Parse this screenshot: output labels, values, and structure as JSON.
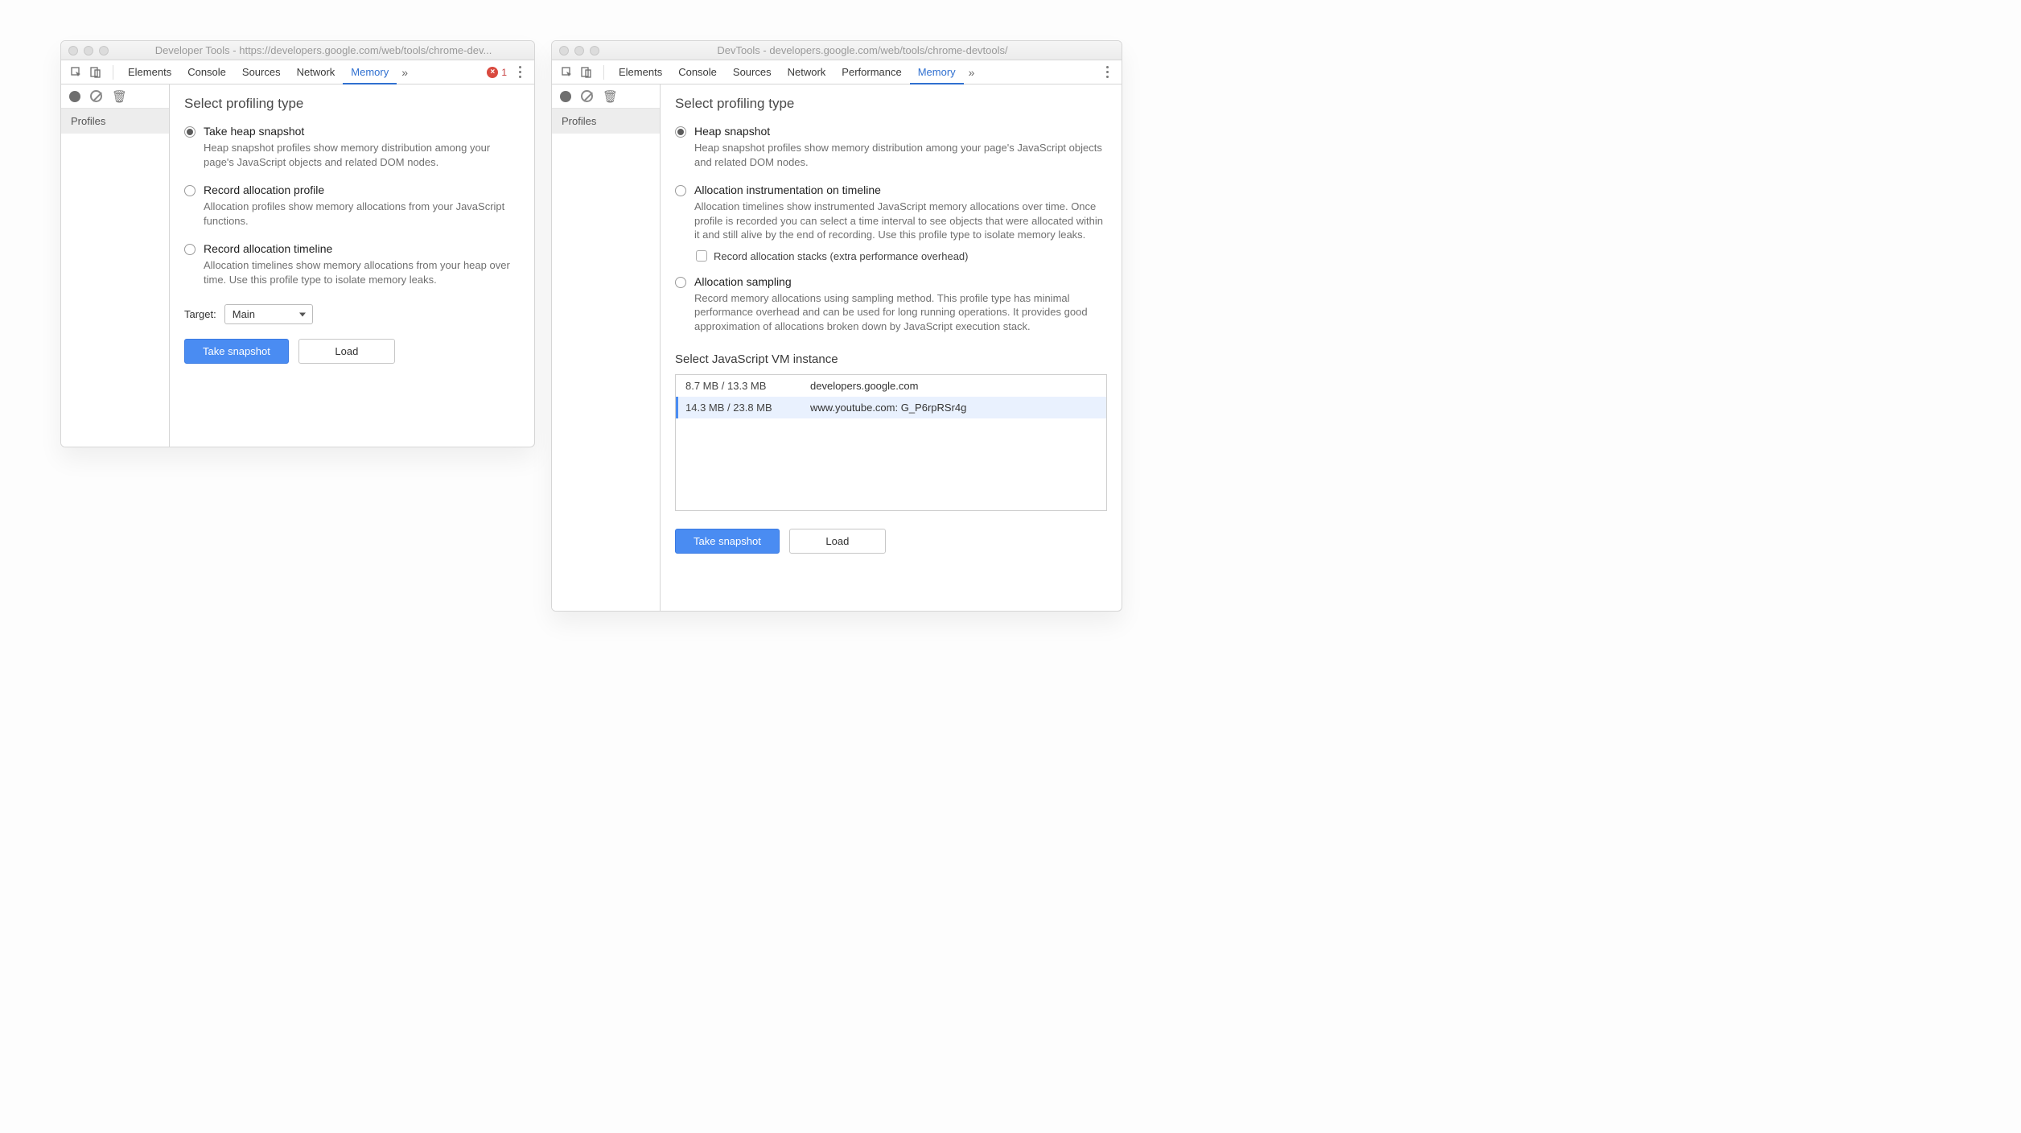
{
  "window1": {
    "title": "Developer Tools - https://developers.google.com/web/tools/chrome-dev...",
    "tabs": [
      "Elements",
      "Console",
      "Sources",
      "Network",
      "Memory"
    ],
    "active_tab": "Memory",
    "error_count": "1",
    "sidebar": {
      "profiles_label": "Profiles"
    },
    "heading": "Select profiling type",
    "options": [
      {
        "title": "Take heap snapshot",
        "desc": "Heap snapshot profiles show memory distribution among your page's JavaScript objects and related DOM nodes.",
        "checked": true
      },
      {
        "title": "Record allocation profile",
        "desc": "Allocation profiles show memory allocations from your JavaScript functions.",
        "checked": false
      },
      {
        "title": "Record allocation timeline",
        "desc": "Allocation timelines show memory allocations from your heap over time. Use this profile type to isolate memory leaks.",
        "checked": false
      }
    ],
    "target_label": "Target:",
    "target_value": "Main",
    "primary_button": "Take snapshot",
    "secondary_button": "Load"
  },
  "window2": {
    "title": "DevTools - developers.google.com/web/tools/chrome-devtools/",
    "tabs": [
      "Elements",
      "Console",
      "Sources",
      "Network",
      "Performance",
      "Memory"
    ],
    "active_tab": "Memory",
    "sidebar": {
      "profiles_label": "Profiles"
    },
    "heading": "Select profiling type",
    "options": [
      {
        "title": "Heap snapshot",
        "desc": "Heap snapshot profiles show memory distribution among your page's JavaScript objects and related DOM nodes.",
        "checked": true
      },
      {
        "title": "Allocation instrumentation on timeline",
        "desc": "Allocation timelines show instrumented JavaScript memory allocations over time. Once profile is recorded you can select a time interval to see objects that were allocated within it and still alive by the end of recording. Use this profile type to isolate memory leaks.",
        "checked": false,
        "subopt": "Record allocation stacks (extra performance overhead)"
      },
      {
        "title": "Allocation sampling",
        "desc": "Record memory allocations using sampling method. This profile type has minimal performance overhead and can be used for long running operations. It provides good approximation of allocations broken down by JavaScript execution stack.",
        "checked": false
      }
    ],
    "vm_heading": "Select JavaScript VM instance",
    "vm_instances": [
      {
        "size": "8.7 MB / 13.3 MB",
        "origin": "developers.google.com",
        "selected": false
      },
      {
        "size": "14.3 MB / 23.8 MB",
        "origin": "www.youtube.com: G_P6rpRSr4g",
        "selected": true
      }
    ],
    "primary_button": "Take snapshot",
    "secondary_button": "Load"
  }
}
